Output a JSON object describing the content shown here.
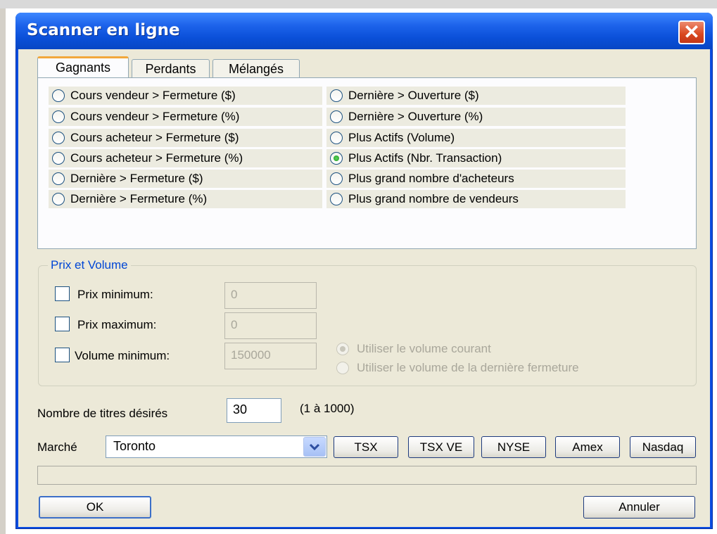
{
  "window": {
    "title": "Scanner en ligne",
    "close_symbol": "✕"
  },
  "tabs": [
    {
      "label": "Gagnants",
      "selected": true
    },
    {
      "label": "Perdants",
      "selected": false
    },
    {
      "label": "Mélangés",
      "selected": false
    }
  ],
  "criteria": {
    "left": [
      {
        "label": "Cours vendeur > Fermeture ($)",
        "selected": false
      },
      {
        "label": "Cours vendeur > Fermeture (%)",
        "selected": false
      },
      {
        "label": "Cours acheteur > Fermeture ($)",
        "selected": false
      },
      {
        "label": "Cours acheteur > Fermeture (%)",
        "selected": false
      },
      {
        "label": "Dernière > Fermeture ($)",
        "selected": false
      },
      {
        "label": "Dernière > Fermeture (%)",
        "selected": false
      }
    ],
    "right": [
      {
        "label": "Dernière > Ouverture ($)",
        "selected": false
      },
      {
        "label": "Dernière > Ouverture (%)",
        "selected": false
      },
      {
        "label": "Plus Actifs (Volume)",
        "selected": false
      },
      {
        "label": "Plus Actifs (Nbr. Transaction)",
        "selected": true
      },
      {
        "label": "Plus grand nombre d'acheteurs",
        "selected": false
      },
      {
        "label": "Plus grand nombre de vendeurs",
        "selected": false
      }
    ]
  },
  "price_volume": {
    "title": "Prix et Volume",
    "min_price_label": "Prix minimum:",
    "min_price_value": "0",
    "max_price_label": "Prix maximum:",
    "max_price_value": "0",
    "min_volume_label": "Volume minimum:",
    "min_volume_value": "150000",
    "volume_options": [
      {
        "label": "Utiliser le volume courant",
        "selected": true
      },
      {
        "label": "Utiliser le volume de la dernière fermeture",
        "selected": false
      }
    ]
  },
  "count": {
    "label": "Nombre de titres désirés",
    "value": "30",
    "range_hint": "(1 à 1000)"
  },
  "market": {
    "label": "Marché",
    "selected": "Toronto",
    "buttons": [
      "TSX",
      "TSX VE",
      "NYSE",
      "Amex",
      "Nasdaq"
    ]
  },
  "actions": {
    "ok": "OK",
    "cancel": "Annuler"
  }
}
